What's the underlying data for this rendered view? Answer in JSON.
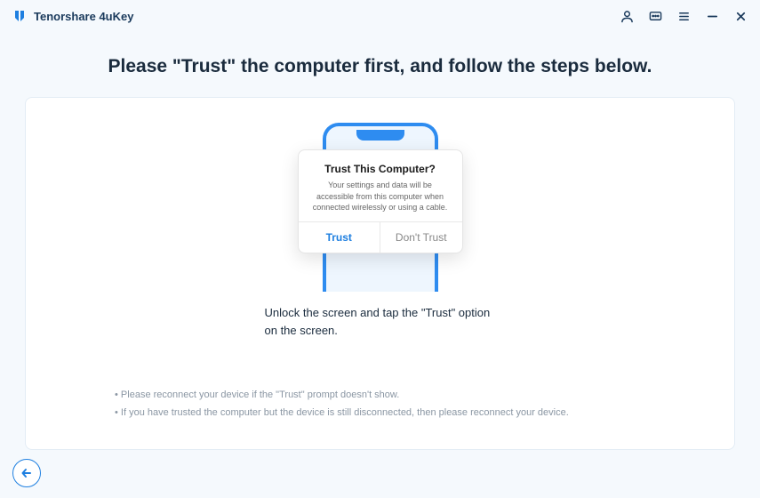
{
  "titlebar": {
    "app_name": "Tenorshare 4uKey"
  },
  "heading": "Please \"Trust\" the computer first, and follow the steps below.",
  "trust_dialog": {
    "title": "Trust This Computer?",
    "body": "Your settings and data will be accessible from this computer when connected wirelessly or using a cable.",
    "trust_label": "Trust",
    "dont_trust_label": "Don't Trust"
  },
  "instruction": "Unlock the screen and tap the \"Trust\" option on the screen.",
  "tips": {
    "item1": "Please reconnect your device if the \"Trust\" prompt doesn't show.",
    "item2": "If you have trusted the computer but the device is still disconnected, then please reconnect your device."
  }
}
